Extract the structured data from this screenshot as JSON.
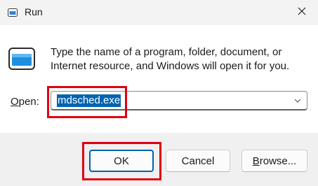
{
  "window": {
    "title": "Run",
    "app_icon": "run-icon",
    "close_icon": "close-icon"
  },
  "prompt": {
    "icon": "run-icon",
    "text": "Type the name of a program, folder, document, or Internet resource, and Windows will open it for you."
  },
  "open_field": {
    "label_accel": "O",
    "label_rest": "pen:",
    "value": "mdsched.exe",
    "dropdown_icon": "chevron-down-icon"
  },
  "buttons": {
    "ok": "OK",
    "cancel": "Cancel",
    "browse_accel": "B",
    "browse_rest": "rowse..."
  },
  "colors": {
    "selection": "#0063b1",
    "highlight": "#e0000e",
    "content_bg": "#ffffff",
    "footer_bg": "#f0f0f0"
  }
}
